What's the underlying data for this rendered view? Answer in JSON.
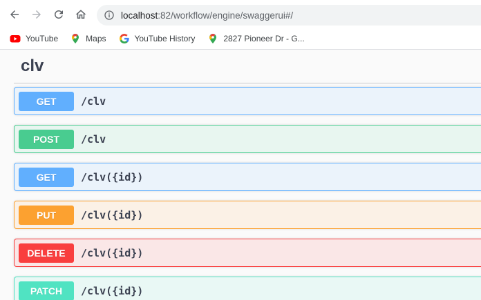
{
  "browser": {
    "url_host": "localhost",
    "url_rest": ":82/workflow/engine/swaggerui#/",
    "bookmarks": [
      {
        "label": "YouTube",
        "icon": "youtube-icon"
      },
      {
        "label": "Maps",
        "icon": "maps-pin-icon"
      },
      {
        "label": "YouTube History",
        "icon": "google-icon"
      },
      {
        "label": "2827 Pioneer Dr - G...",
        "icon": "maps-pin-icon"
      }
    ]
  },
  "section": {
    "title": "clv"
  },
  "operations": [
    {
      "method": "GET",
      "path": "/clv",
      "method_color": "#61affe",
      "bg": "#ebf3fb",
      "border": "#61affe"
    },
    {
      "method": "POST",
      "path": "/clv",
      "method_color": "#49cc90",
      "bg": "#e8f6f0",
      "border": "#49cc90"
    },
    {
      "method": "GET",
      "path": "/clv({id})",
      "method_color": "#61affe",
      "bg": "#ebf3fb",
      "border": "#61affe"
    },
    {
      "method": "PUT",
      "path": "/clv({id})",
      "method_color": "#fca130",
      "bg": "#fbf1e6",
      "border": "#fca130"
    },
    {
      "method": "DELETE",
      "path": "/clv({id})",
      "method_color": "#f93e3e",
      "bg": "#fae7e7",
      "border": "#f93e3e"
    },
    {
      "method": "PATCH",
      "path": "/clv({id})",
      "method_color": "#50e3c2",
      "bg": "#e9f8f5",
      "border": "#50e3c2"
    }
  ]
}
